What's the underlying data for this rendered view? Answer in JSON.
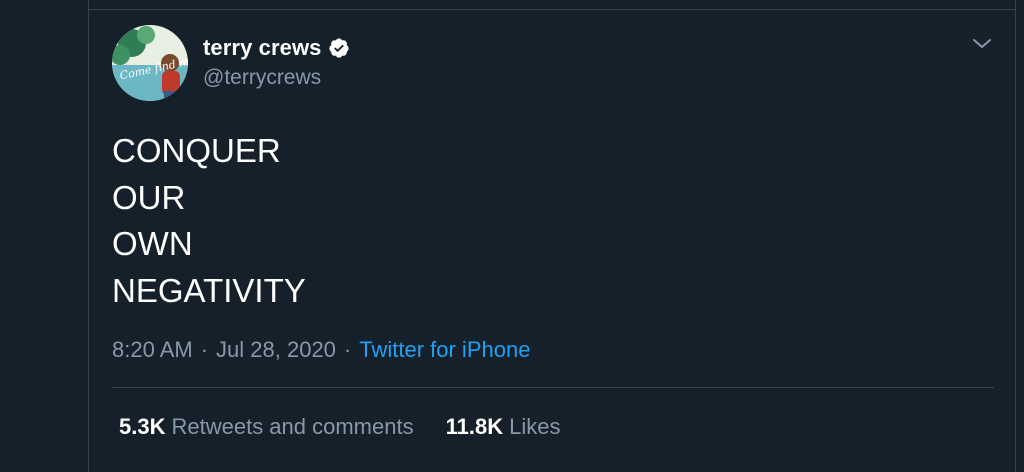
{
  "user": {
    "name": "terry crews",
    "handle": "@terrycrews",
    "avatar_text": "Come find me"
  },
  "tweet": {
    "lines": [
      "CONQUER",
      "OUR",
      "OWN",
      "NEGATIVITY"
    ],
    "time": "8:20 AM",
    "date": "Jul 28, 2020",
    "separator": "·",
    "source": "Twitter for iPhone"
  },
  "stats": {
    "retweets_count": "5.3K",
    "retweets_label": "Retweets and comments",
    "likes_count": "11.8K",
    "likes_label": "Likes"
  },
  "icons": {
    "verified": "verified-badge-icon",
    "menu": "chevron-down-icon"
  },
  "colors": {
    "background": "#15202b",
    "border": "#38444d",
    "secondary_text": "#8899a6",
    "link": "#1da1f2"
  }
}
